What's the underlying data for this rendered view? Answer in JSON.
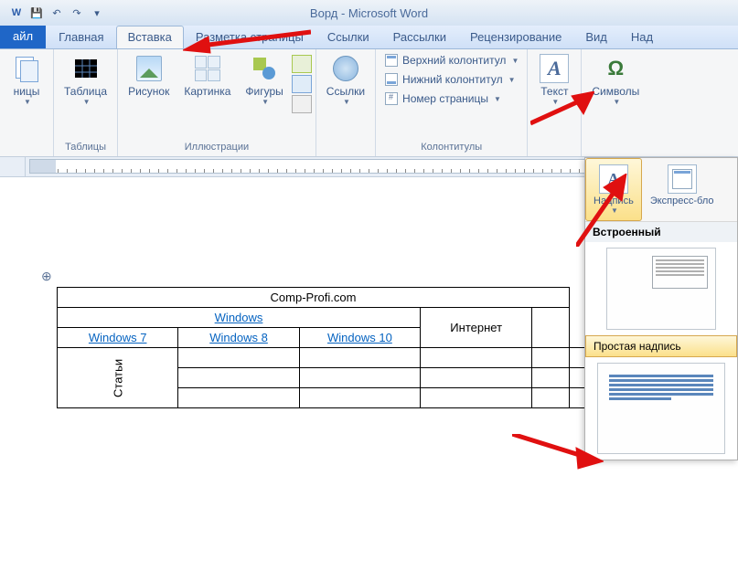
{
  "window": {
    "title": "Ворд - Microsoft Word"
  },
  "tabs": {
    "file": "айл",
    "home": "Главная",
    "insert": "Вставка",
    "layout": "Разметка страницы",
    "references": "Ссылки",
    "mailings": "Рассылки",
    "review": "Рецензирование",
    "view": "Вид",
    "addins": "Над"
  },
  "ribbon": {
    "pages": {
      "btn": "ницы",
      "group": ""
    },
    "tables": {
      "btn": "Таблица",
      "group": "Таблицы"
    },
    "illustrations": {
      "picture": "Рисунок",
      "clipart": "Картинка",
      "shapes": "Фигуры",
      "group": "Иллюстрации"
    },
    "links": {
      "btn": "Ссылки",
      "group": ""
    },
    "headerfooter": {
      "header": "Верхний колонтитул",
      "footer": "Нижний колонтитул",
      "pagenum": "Номер страницы",
      "group": "Колонтитулы"
    },
    "text": {
      "btn": "Текст"
    },
    "symbols": {
      "btn": "Символы",
      "glyph": "Ω"
    }
  },
  "gallery": {
    "textbox": "Надпись",
    "quickparts": "Экспресс-бло",
    "section_builtin": "Встроенный",
    "item_simple": "Простая надпись"
  },
  "document": {
    "table": {
      "merged_title": "Comp-Profi.com",
      "row2": "Windows",
      "row3": [
        "Windows 7",
        "Windows 8",
        "Windows 10",
        "Интернет"
      ],
      "side": "Статьи"
    }
  }
}
